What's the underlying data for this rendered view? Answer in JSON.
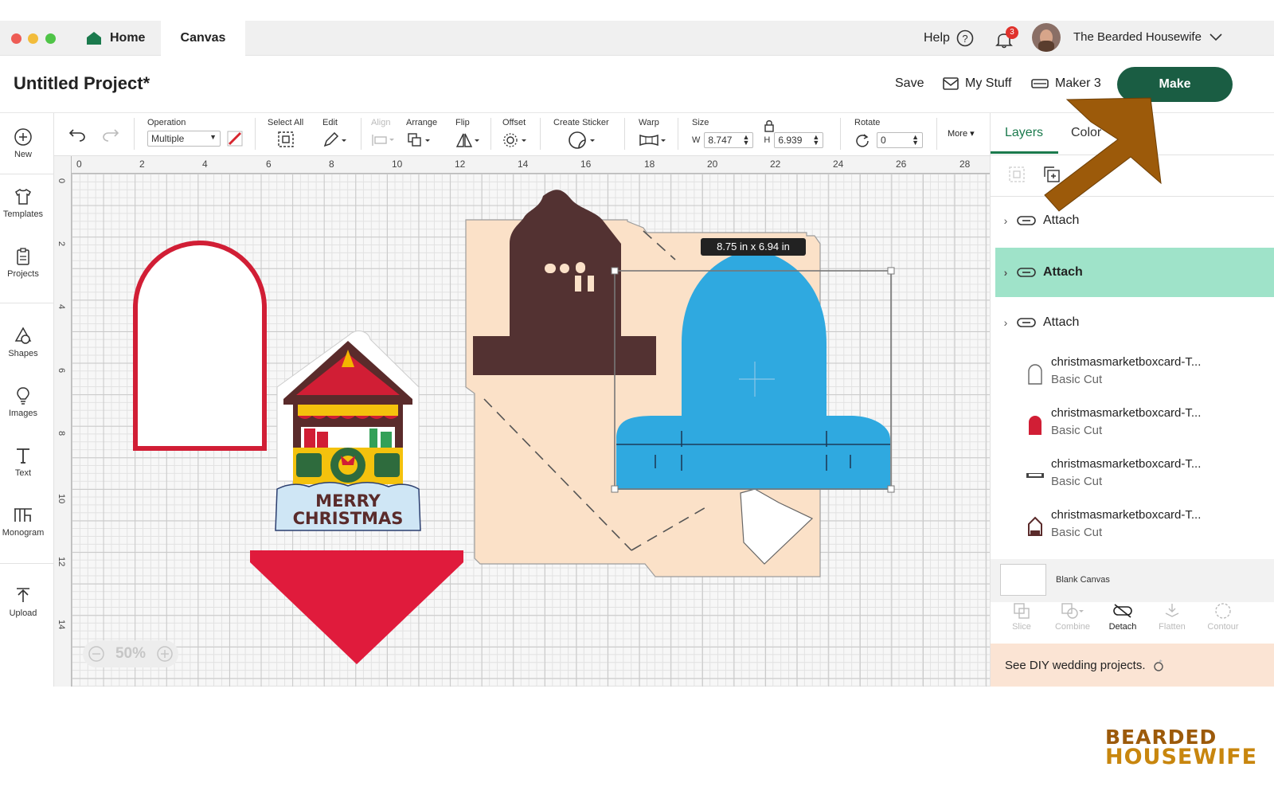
{
  "titlebar": {
    "tabs": [
      {
        "label": "Home"
      },
      {
        "label": "Canvas"
      }
    ],
    "help_label": "Help",
    "notification_count": "3",
    "user_name": "The Bearded Housewife"
  },
  "project": {
    "title": "Untitled Project*",
    "save_label": "Save",
    "mystuff_label": "My Stuff",
    "machine_label": "Maker 3",
    "make_label": "Make"
  },
  "toolbar": {
    "operation_label": "Operation",
    "operation_value": "Multiple",
    "select_all_label": "Select All",
    "edit_label": "Edit",
    "align_label": "Align",
    "arrange_label": "Arrange",
    "flip_label": "Flip",
    "offset_label": "Offset",
    "sticker_label": "Create Sticker",
    "warp_label": "Warp",
    "size_label": "Size",
    "w_label": "W",
    "w_value": "8.747",
    "h_label": "H",
    "h_value": "6.939",
    "rotate_label": "Rotate",
    "rotate_value": "0",
    "more_label": "More"
  },
  "sidebar": {
    "items": [
      {
        "label": "New"
      },
      {
        "label": "Templates"
      },
      {
        "label": "Projects"
      },
      {
        "label": "Shapes"
      },
      {
        "label": "Images"
      },
      {
        "label": "Text"
      },
      {
        "label": "Monogram"
      },
      {
        "label": "Upload"
      }
    ]
  },
  "canvas": {
    "ruler_x": [
      "0",
      "2",
      "4",
      "6",
      "8",
      "10",
      "12",
      "14",
      "16",
      "18",
      "20",
      "22",
      "24",
      "26",
      "28"
    ],
    "ruler_y": [
      "0",
      "2",
      "4",
      "6",
      "8",
      "10",
      "12",
      "14"
    ],
    "zoom": "50%",
    "size_tooltip": "8.75  in x 6.94  in",
    "sign_line1": "MERRY",
    "sign_line2": "CHRISTMAS"
  },
  "panel": {
    "tabs": [
      {
        "label": "Layers"
      },
      {
        "label": "Color"
      }
    ],
    "groups": [
      {
        "label": "Attach"
      },
      {
        "label": "Attach"
      },
      {
        "label": "Attach"
      }
    ],
    "layers": [
      {
        "name": "christmasmarketboxcard-T...",
        "sub": "Basic Cut"
      },
      {
        "name": "christmasmarketboxcard-T...",
        "sub": "Basic Cut"
      },
      {
        "name": "christmasmarketboxcard-T...",
        "sub": "Basic Cut"
      },
      {
        "name": "christmasmarketboxcard-T...",
        "sub": "Basic Cut"
      }
    ],
    "blank_canvas": "Blank Canvas",
    "tools": [
      {
        "label": "Slice"
      },
      {
        "label": "Combine"
      },
      {
        "label": "Detach"
      },
      {
        "label": "Flatten"
      },
      {
        "label": "Contour"
      }
    ],
    "promo": "See DIY wedding projects."
  },
  "watermark": {
    "line1": "BEARDED",
    "line2": "HOUSEWIFE"
  },
  "colors": {
    "accent": "#1a5d43",
    "selected_row": "#9fe3c9",
    "arrow": "#9c5a0a"
  }
}
